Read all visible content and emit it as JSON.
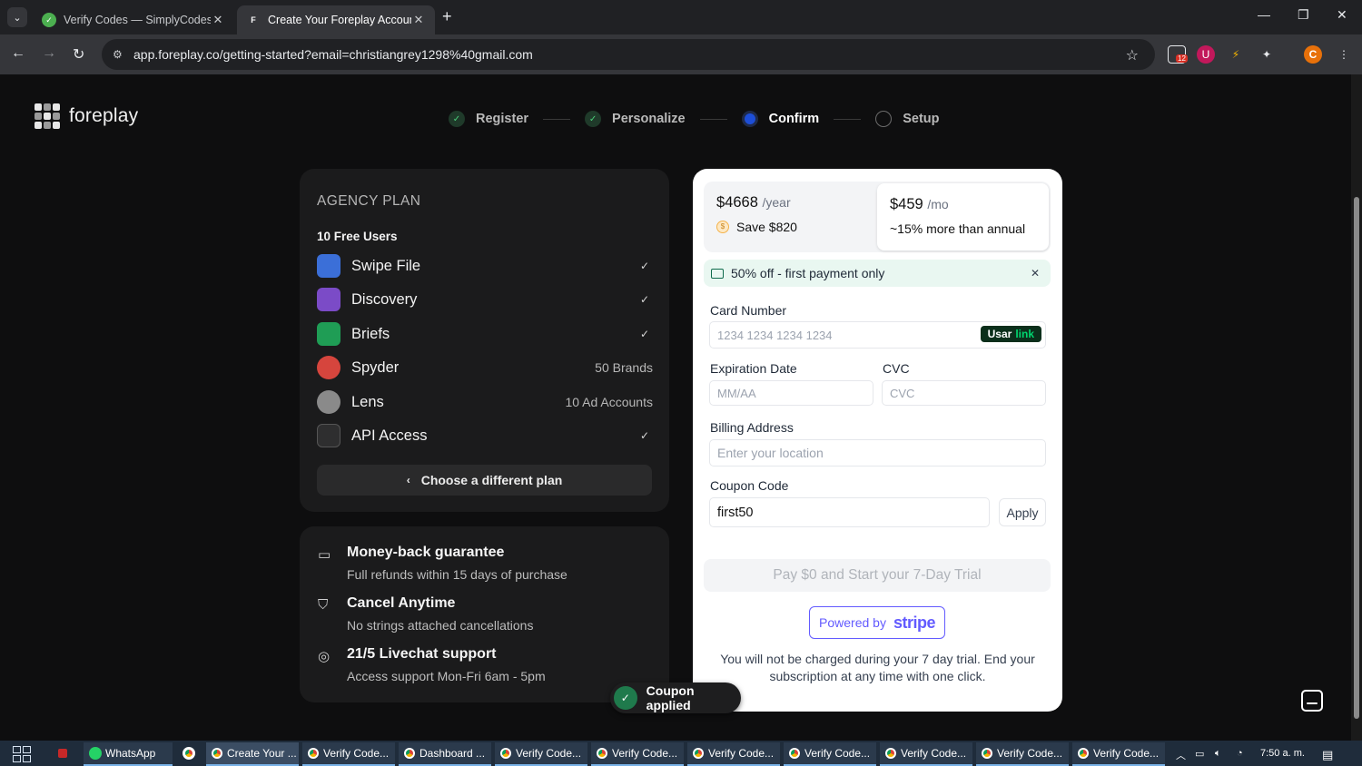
{
  "browser": {
    "tabs": [
      {
        "title": "Verify Codes — SimplyCodes",
        "favicon": "simplycodes-icon"
      },
      {
        "title": "Create Your Foreplay Account |",
        "favicon": "foreplay-icon"
      }
    ],
    "url": "app.foreplay.co/getting-started?email=christiangrey1298%40gmail.com",
    "extension_badge": "12",
    "profile_letter": "C"
  },
  "brand": {
    "name": "foreplay"
  },
  "steps": [
    {
      "label": "Register",
      "state": "done"
    },
    {
      "label": "Personalize",
      "state": "done"
    },
    {
      "label": "Confirm",
      "state": "current"
    },
    {
      "label": "Setup",
      "state": "todo"
    }
  ],
  "plan": {
    "title": "AGENCY PLAN",
    "free_users": "10 Free Users",
    "features": [
      {
        "name": "Swipe File",
        "value": "✓",
        "icon": "swipe-file-icon",
        "color": "#3b6fd8"
      },
      {
        "name": "Discovery",
        "value": "✓",
        "icon": "discovery-icon",
        "color": "#7b4bc7"
      },
      {
        "name": "Briefs",
        "value": "✓",
        "icon": "briefs-icon",
        "color": "#1f9d55"
      },
      {
        "name": "Spyder",
        "value": "50 Brands",
        "icon": "spyder-icon",
        "color": "#d6453d"
      },
      {
        "name": "Lens",
        "value": "10 Ad Accounts",
        "icon": "lens-icon",
        "color": "#8a8a8a"
      },
      {
        "name": "API Access",
        "value": "✓",
        "icon": "api-icon",
        "color": "#3a3a3a"
      }
    ],
    "change_plan": "Choose a different plan"
  },
  "guarantees": [
    {
      "title": "Money-back guarantee",
      "desc": "Full refunds within 15 days of purchase",
      "icon": "money-back-icon"
    },
    {
      "title": "Cancel Anytime",
      "desc": "No strings attached cancellations",
      "icon": "shield-icon"
    },
    {
      "title": "21/5 Livechat support",
      "desc": "Access support Mon-Fri 6am - 5pm",
      "icon": "lifebuoy-icon"
    }
  ],
  "payment": {
    "annual": {
      "price": "$4668",
      "per": "/year",
      "note": "Save $820"
    },
    "monthly": {
      "price": "$459",
      "per": "/mo",
      "note": "~15% more than annual"
    },
    "promo": "50% off - first payment only",
    "card_label": "Card Number",
    "card_placeholder": "1234 1234 1234 1234",
    "link_use": "Usar",
    "link_brand": "link",
    "exp_label": "Expiration Date",
    "exp_placeholder": "MM/AA",
    "cvc_label": "CVC",
    "cvc_placeholder": "CVC",
    "billing_label": "Billing Address",
    "billing_placeholder": "Enter your location",
    "coupon_label": "Coupon Code",
    "coupon_value": "first50",
    "apply": "Apply",
    "pay_button": "Pay $0 and Start your 7-Day Trial",
    "powered_by": "Powered by",
    "stripe": "stripe",
    "trial_note": "You will not be charged during your 7 day trial. End your subscription at any time with one click."
  },
  "toast": {
    "text": "Coupon applied"
  },
  "taskbar": {
    "items": [
      {
        "label": "WhatsApp",
        "icon": "whatsapp-icon"
      },
      {
        "label": "Create Your ...",
        "icon": "chrome-icon"
      },
      {
        "label": "Verify Code...",
        "icon": "chrome-icon"
      },
      {
        "label": "Dashboard ...",
        "icon": "chrome-icon"
      },
      {
        "label": "Verify Code...",
        "icon": "chrome-icon"
      },
      {
        "label": "Verify Code...",
        "icon": "chrome-icon"
      },
      {
        "label": "Verify Code...",
        "icon": "chrome-icon"
      },
      {
        "label": "Verify Code...",
        "icon": "chrome-icon"
      },
      {
        "label": "Verify Code...",
        "icon": "chrome-icon"
      },
      {
        "label": "Verify Code...",
        "icon": "chrome-icon"
      },
      {
        "label": "Verify Code...",
        "icon": "chrome-icon"
      }
    ],
    "clock": "7:50 a. m."
  }
}
